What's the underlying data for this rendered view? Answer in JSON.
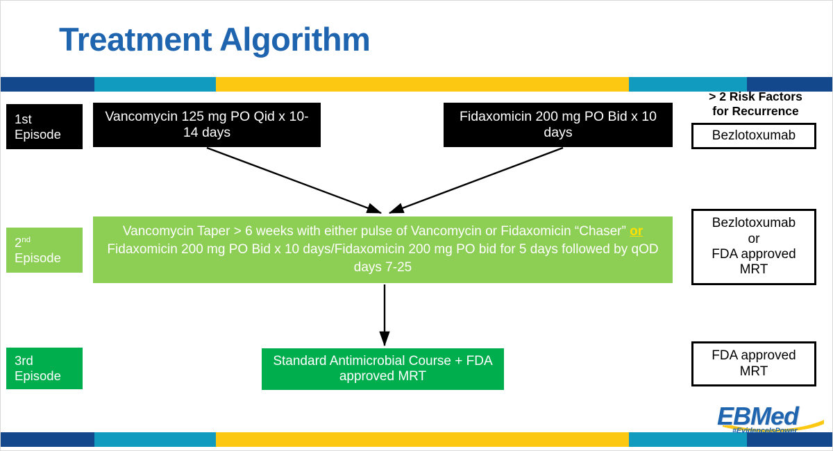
{
  "slide": {
    "title": "Treatment Algorithm"
  },
  "bands": {
    "navy": "#13488C",
    "teal": "#119BBF",
    "gold": "#FCC811"
  },
  "colors": {
    "title_blue": "#1F64AE",
    "lime_green": "#8DCE54",
    "green": "#00AE4D",
    "black": "#000000",
    "or_highlight": "#FFE100"
  },
  "episodes": [
    {
      "ordinal": "1",
      "suffix": "st",
      "plain": "1st",
      "word": "Episode",
      "style": "black"
    },
    {
      "ordinal": "2",
      "suffix": "nd",
      "plain": "2",
      "word": "Episode",
      "style": "lime"
    },
    {
      "ordinal": "3",
      "suffix": "rd",
      "plain": "3rd",
      "word": "Episode",
      "style": "green"
    }
  ],
  "treatments": {
    "first_line_left": "Vancomycin 125 mg PO Qid x 10-14 days",
    "first_line_right": "Fidaxomicin 200 mg PO Bid x 10 days",
    "second_line": {
      "part1": "Vancomycin Taper > 6 weeks with either pulse of Vancomycin or Fidaxomicin “Chaser” ",
      "or": "or",
      "part2": " Fidaxomicin 200 mg PO Bid x 10 days/Fidaxomicin 200 mg PO bid for 5 days followed by qOD days 7-25"
    },
    "third_line": "Standard Antimicrobial Course + FDA approved MRT"
  },
  "right_column": {
    "header_line1": "> 2 Risk Factors",
    "header_line2": "for Recurrence",
    "box1": "Bezlotoxumab",
    "box2": "Bezlotoxumab\nor\nFDA approved\nMRT",
    "box3": "FDA approved\nMRT"
  },
  "logo": {
    "name": "EBMed",
    "tagline": "#EvidenceIsPower"
  }
}
